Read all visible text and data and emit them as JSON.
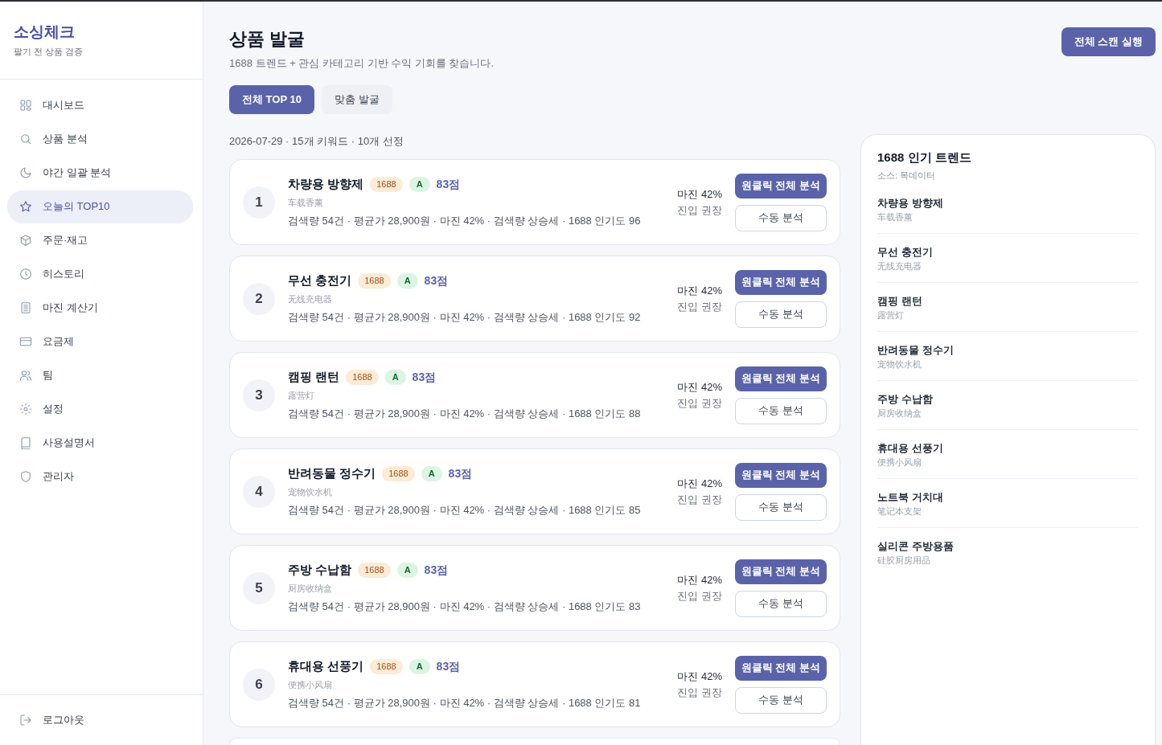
{
  "sidebar": {
    "logo": "소싱체크",
    "tagline": "팔기 전 상품 검증",
    "items": [
      {
        "label": "대시보드",
        "selected": false
      },
      {
        "label": "상품 분석",
        "selected": false
      },
      {
        "label": "야간 일괄 분석",
        "selected": false
      },
      {
        "label": "오늘의 TOP10",
        "selected": true
      },
      {
        "label": "주문·재고",
        "selected": false
      },
      {
        "label": "히스토리",
        "selected": false
      },
      {
        "label": "마진 계산기",
        "selected": false
      },
      {
        "label": "요금제",
        "selected": false
      },
      {
        "label": "팀",
        "selected": false
      },
      {
        "label": "설정",
        "selected": false
      },
      {
        "label": "사용설명서",
        "selected": false
      },
      {
        "label": "관리자",
        "selected": false
      }
    ],
    "footer_item": {
      "label": "로그아웃"
    }
  },
  "header": {
    "title": "상품 발굴",
    "subtitle": "1688 트렌드 + 관심 카테고리 기반 수익 기회를 찾습니다.",
    "action": "전체 스캔 실행"
  },
  "tabs": [
    {
      "label": "전체 TOP 10",
      "selected": true
    },
    {
      "label": "맞춤 발굴",
      "selected": false
    }
  ],
  "summary": "2026-07-29 · 15개 키워드 · 10개 선정",
  "products": [
    {
      "rank": "1",
      "name": "차량용 방향제",
      "source_tag": "1688",
      "grade": "A",
      "score": "83점",
      "chinese_name": "车载香薰",
      "stats": "검색량 54건 · 평균가 28,900원 · 마진 42% · 검색량 상승세 · 1688 인기도 96",
      "margin": "마진 42%",
      "verdict": "진입 권장",
      "primary_action": "원클릭 전체 분석",
      "secondary_action": "수동 분석"
    },
    {
      "rank": "2",
      "name": "무선 충전기",
      "source_tag": "1688",
      "grade": "A",
      "score": "83점",
      "chinese_name": "无线充电器",
      "stats": "검색량 54건 · 평균가 28,900원 · 마진 42% · 검색량 상승세 · 1688 인기도 92",
      "margin": "마진 42%",
      "verdict": "진입 권장",
      "primary_action": "원클릭 전체 분석",
      "secondary_action": "수동 분석"
    },
    {
      "rank": "3",
      "name": "캠핑 랜턴",
      "source_tag": "1688",
      "grade": "A",
      "score": "83점",
      "chinese_name": "露营灯",
      "stats": "검색량 54건 · 평균가 28,900원 · 마진 42% · 검색량 상승세 · 1688 인기도 88",
      "margin": "마진 42%",
      "verdict": "진입 권장",
      "primary_action": "원클릭 전체 분석",
      "secondary_action": "수동 분석"
    },
    {
      "rank": "4",
      "name": "반려동물 정수기",
      "source_tag": "1688",
      "grade": "A",
      "score": "83점",
      "chinese_name": "宠物饮水机",
      "stats": "검색량 54건 · 평균가 28,900원 · 마진 42% · 검색량 상승세 · 1688 인기도 85",
      "margin": "마진 42%",
      "verdict": "진입 권장",
      "primary_action": "원클릭 전체 분석",
      "secondary_action": "수동 분석"
    },
    {
      "rank": "5",
      "name": "주방 수납함",
      "source_tag": "1688",
      "grade": "A",
      "score": "83점",
      "chinese_name": "厨房收纳盒",
      "stats": "검색량 54건 · 평균가 28,900원 · 마진 42% · 검색량 상승세 · 1688 인기도 83",
      "margin": "마진 42%",
      "verdict": "진입 권장",
      "primary_action": "원클릭 전체 분석",
      "secondary_action": "수동 분석"
    },
    {
      "rank": "6",
      "name": "휴대용 선풍기",
      "source_tag": "1688",
      "grade": "A",
      "score": "83점",
      "chinese_name": "便携小风扇",
      "stats": "검색량 54건 · 평균가 28,900원 · 마진 42% · 검색량 상승세 · 1688 인기도 81",
      "margin": "마진 42%",
      "verdict": "진입 권장",
      "primary_action": "원클릭 전체 분석",
      "secondary_action": "수동 분석"
    }
  ],
  "trend_panel": {
    "title": "1688 인기 트렌드",
    "source": "소스: 목데이터",
    "items": [
      {
        "name": "차량용 방향제",
        "chinese_name": "车载香薰"
      },
      {
        "name": "무선 충전기",
        "chinese_name": "无线充电器"
      },
      {
        "name": "캠핑 랜턴",
        "chinese_name": "露营灯"
      },
      {
        "name": "반려동물 정수기",
        "chinese_name": "宠物饮水机"
      },
      {
        "name": "주방 수납함",
        "chinese_name": "厨房收纳盒"
      },
      {
        "name": "휴대용 선풍기",
        "chinese_name": "便携小风扇"
      },
      {
        "name": "노트북 거치대",
        "chinese_name": "笔记本支架"
      },
      {
        "name": "실리콘 주방용품",
        "chinese_name": "硅胶厨房用品"
      }
    ]
  }
}
